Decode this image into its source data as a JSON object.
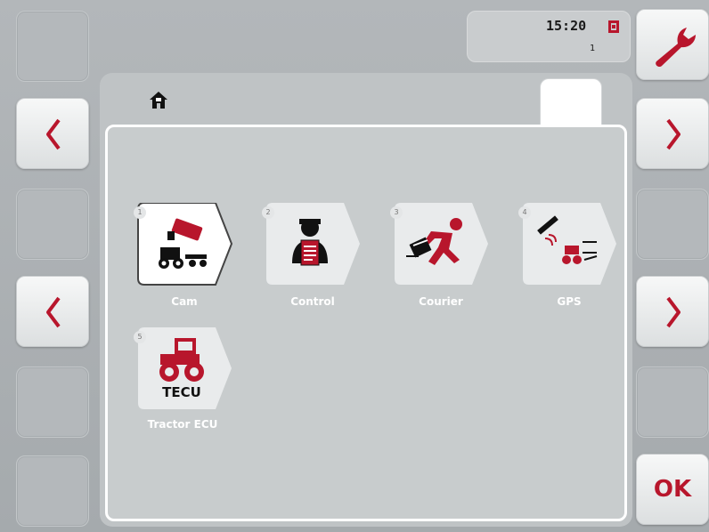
{
  "status": {
    "time": "15:20",
    "sub_number": "1"
  },
  "header": {
    "home_icon": "home-icon"
  },
  "softkeys": {
    "left": [
      {
        "name": "softkey-left-1",
        "icon": "blank"
      },
      {
        "name": "softkey-left-2",
        "icon": "chevron-left-icon"
      },
      {
        "name": "softkey-left-3",
        "icon": "blank"
      },
      {
        "name": "softkey-left-4",
        "icon": "chevron-left-icon"
      },
      {
        "name": "softkey-left-5",
        "icon": "blank"
      },
      {
        "name": "softkey-left-6",
        "icon": "blank"
      }
    ],
    "right": [
      {
        "name": "softkey-right-1",
        "icon": "wrench-icon"
      },
      {
        "name": "softkey-right-2",
        "icon": "chevron-right-icon"
      },
      {
        "name": "softkey-right-3",
        "icon": "blank"
      },
      {
        "name": "softkey-right-4",
        "icon": "chevron-right-icon"
      },
      {
        "name": "softkey-right-5",
        "icon": "blank"
      },
      {
        "name": "softkey-right-6",
        "icon": "ok",
        "label": "OK"
      }
    ]
  },
  "apps": [
    {
      "number": "1",
      "label": "Cam",
      "icon": "camera-tractor-icon",
      "selected": true
    },
    {
      "number": "2",
      "label": "Control",
      "icon": "operator-clipboard-icon",
      "selected": false
    },
    {
      "number": "3",
      "label": "Courier",
      "icon": "running-courier-icon",
      "selected": false
    },
    {
      "number": "4",
      "label": "GPS",
      "icon": "gps-satellite-tractor-icon",
      "selected": false
    },
    {
      "number": "5",
      "label": "Tractor ECU",
      "icon": "tractor-ecu-icon",
      "icon_text": "TECU",
      "selected": false
    }
  ],
  "colors": {
    "accent_red": "#b8162c",
    "background": "#a9aeb1",
    "panel": "#c8cccd"
  }
}
